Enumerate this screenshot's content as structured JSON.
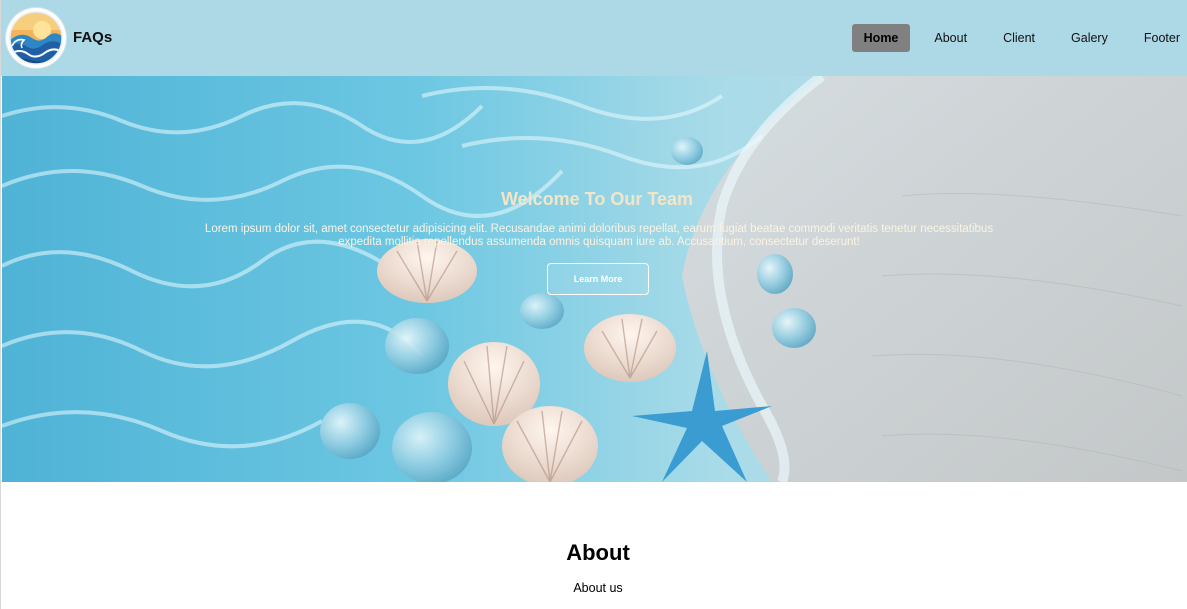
{
  "header": {
    "brand": "FAQs",
    "nav": [
      {
        "label": "Home",
        "active": true
      },
      {
        "label": "About",
        "active": false
      },
      {
        "label": "Client",
        "active": false
      },
      {
        "label": "Galery",
        "active": false
      },
      {
        "label": "Footer",
        "active": false
      }
    ]
  },
  "hero": {
    "title": "Welcome To Our Team",
    "text": "Lorem ipsum dolor sit, amet consectetur adipisicing elit. Recusandae animi doloribus repellat, earum fugiat beatae commodi veritatis tenetur necessitatibus expedita mollitia repellendus assumenda omnis quisquam iure ab. Accusantium, consectetur deserunt!",
    "button": "Learn More"
  },
  "about": {
    "title": "About",
    "subtitle": "About us"
  },
  "colors": {
    "navbar": "#add8e6",
    "active_nav": "#808080",
    "page_bg": "#ffffff"
  }
}
